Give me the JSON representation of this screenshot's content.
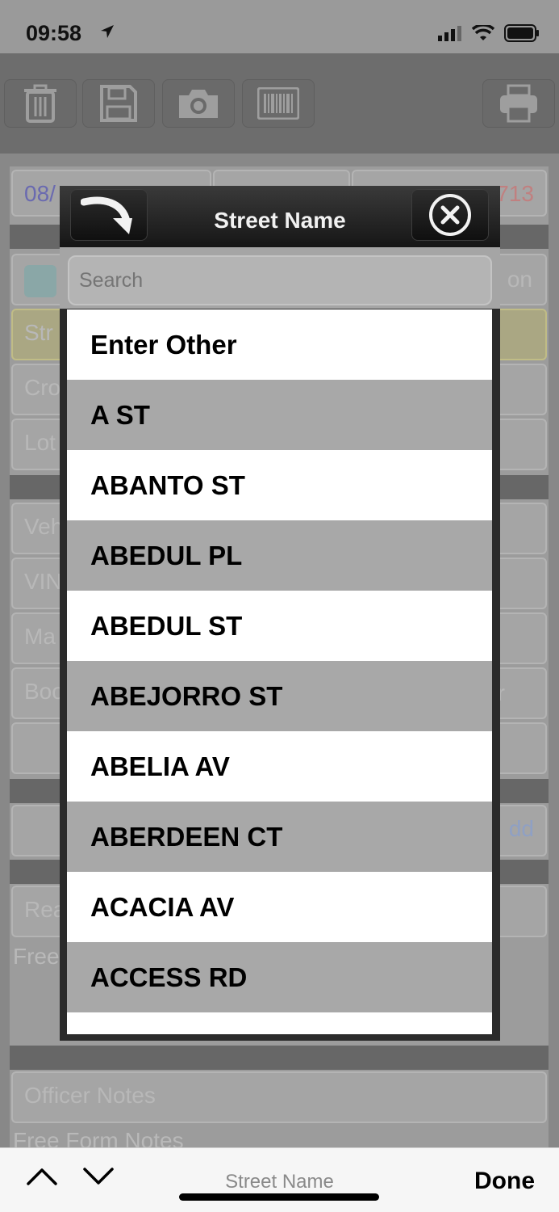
{
  "status_bar": {
    "time": "09:58"
  },
  "background_form": {
    "date_fragment": "08/",
    "number_fragment": "713",
    "left_fragments": [
      "Str",
      "Cro",
      "Lot",
      "Veh",
      "VIN",
      "Ma",
      "Boo",
      "Rea",
      "Free"
    ],
    "right_fragments": [
      "on",
      "r",
      "dd"
    ],
    "officer_notes": "Officer Notes",
    "free_form_notes": "Free Form Notes"
  },
  "modal": {
    "title": "Street Name",
    "search_placeholder": "Search",
    "items": [
      "Enter Other",
      "A ST",
      "ABANTO ST",
      "ABEDUL PL",
      "ABEDUL ST",
      "ABEJORRO ST",
      "ABELIA AV",
      "ABERDEEN CT",
      "ACACIA AV",
      "ACCESS RD",
      ""
    ]
  },
  "keyboard_bar": {
    "field_label": "Street Name",
    "done_label": "Done"
  },
  "icons": {
    "toolbar": [
      "trash-icon",
      "save-icon",
      "camera-icon",
      "barcode-icon",
      "print-icon"
    ],
    "modal": [
      "redo-arrow-icon",
      "close-circle-icon"
    ],
    "keyboard_bar": [
      "chevron-up-icon",
      "chevron-down-icon"
    ]
  }
}
